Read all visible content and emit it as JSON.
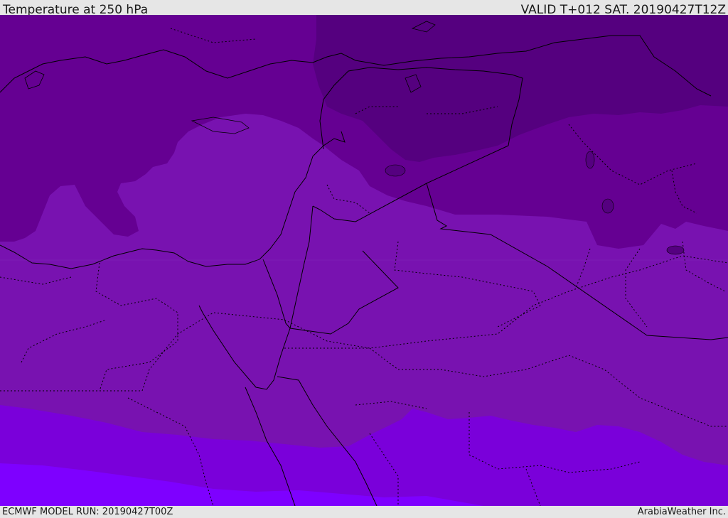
{
  "header": {
    "title": "Temperature at 250 hPa",
    "valid_time": "VALID T+012 SAT. 20190427T12Z"
  },
  "footer": {
    "model_run": "ECMWF MODEL RUN: 20190427T00Z",
    "credit": "ArabiaWeather Inc."
  },
  "map": {
    "variable": "Temperature",
    "pressure_level": "250 hPa",
    "shading_colors": {
      "band_darkest": "#55007f",
      "band_dark": "#650092",
      "band_mid": "#7812b0",
      "band_light": "#7a00da",
      "band_lightest": "#7e00ff"
    },
    "border_color": "#000000"
  }
}
